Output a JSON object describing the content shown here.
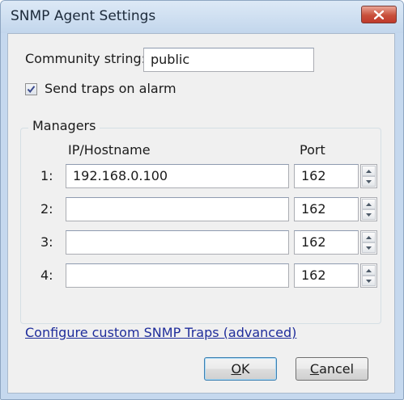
{
  "window": {
    "title": "SNMP Agent Settings"
  },
  "community": {
    "label": "Community string:",
    "value": "public"
  },
  "traps": {
    "label": "Send traps on alarm",
    "checked": true
  },
  "managers": {
    "group_label": "Managers",
    "col_ip": "IP/Hostname",
    "col_port": "Port",
    "rows": [
      {
        "label": "1:",
        "ip": "192.168.0.100",
        "port": "162"
      },
      {
        "label": "2:",
        "ip": "",
        "port": "162"
      },
      {
        "label": "3:",
        "ip": "",
        "port": "162"
      },
      {
        "label": "4:",
        "ip": "",
        "port": "162"
      }
    ]
  },
  "custom_link": "Configure custom SNMP Traps (advanced)",
  "buttons": {
    "ok": {
      "mnemonic": "O",
      "rest": "K"
    },
    "cancel": {
      "mnemonic": "C",
      "rest": "ancel"
    }
  }
}
